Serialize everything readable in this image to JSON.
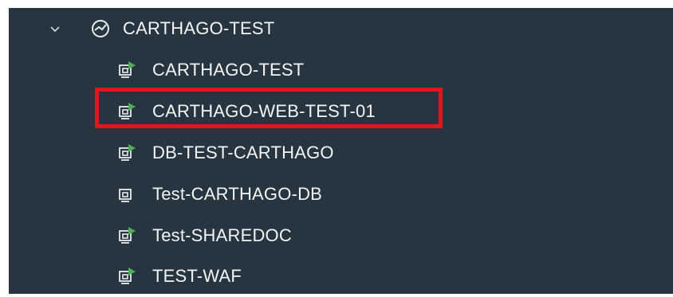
{
  "tree": {
    "group": {
      "label": "CARTHAGO-TEST",
      "expand_icon": "chevron-down-icon",
      "group_icon": "resource-pool-icon",
      "expanded": true
    },
    "items": [
      {
        "label": "CARTHAGO-TEST",
        "icon": "vm-powered-on-icon",
        "powered_on": true
      },
      {
        "label": "CARTHAGO-WEB-TEST-01",
        "icon": "vm-powered-on-icon",
        "powered_on": true,
        "highlighted": true
      },
      {
        "label": "DB-TEST-CARTHAGO",
        "icon": "vm-powered-on-icon",
        "powered_on": true
      },
      {
        "label": "Test-CARTHAGO-DB",
        "icon": "vm-powered-off-icon",
        "powered_on": false
      },
      {
        "label": "Test-SHAREDOC",
        "icon": "vm-powered-on-icon",
        "powered_on": true
      },
      {
        "label": "TEST-WAF",
        "icon": "vm-powered-on-icon",
        "powered_on": true
      }
    ]
  },
  "colors": {
    "panel_bg": "#273540",
    "text": "#f2f5f7",
    "power_on_green": "#4caf50",
    "highlight_red": "#e3161e"
  }
}
